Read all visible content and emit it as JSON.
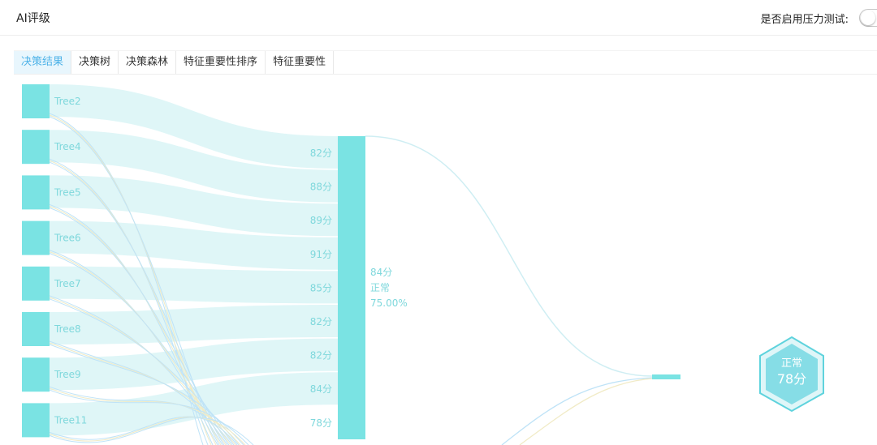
{
  "header": {
    "title": "AI评级",
    "stress_label": "是否启用压力测试:",
    "stress_enabled": false
  },
  "tabs": [
    {
      "label": "决策结果",
      "active": true
    },
    {
      "label": "决策树",
      "active": false
    },
    {
      "label": "决策森林",
      "active": false
    },
    {
      "label": "特征重要性排序",
      "active": false
    },
    {
      "label": "特征重要性",
      "active": false
    }
  ],
  "sankey": {
    "trees": [
      "Tree2",
      "Tree4",
      "Tree5",
      "Tree6",
      "Tree7",
      "Tree8",
      "Tree9",
      "Tree11"
    ],
    "scores": [
      "82分",
      "88分",
      "89分",
      "91分",
      "85分",
      "82分",
      "82分",
      "84分",
      "78分"
    ],
    "aggregate": {
      "score": "84分",
      "status": "正常",
      "percent": "75.00%"
    },
    "result": {
      "status": "正常",
      "score": "78分"
    },
    "colors": {
      "node": "#7ae3e3",
      "link": "#d9f4f6",
      "line_blue": "#bfe3f7",
      "line_yellow": "#f1ebc6",
      "hex_fill": "#7ad8e2",
      "hex_stroke": "#5fd3dd"
    }
  }
}
